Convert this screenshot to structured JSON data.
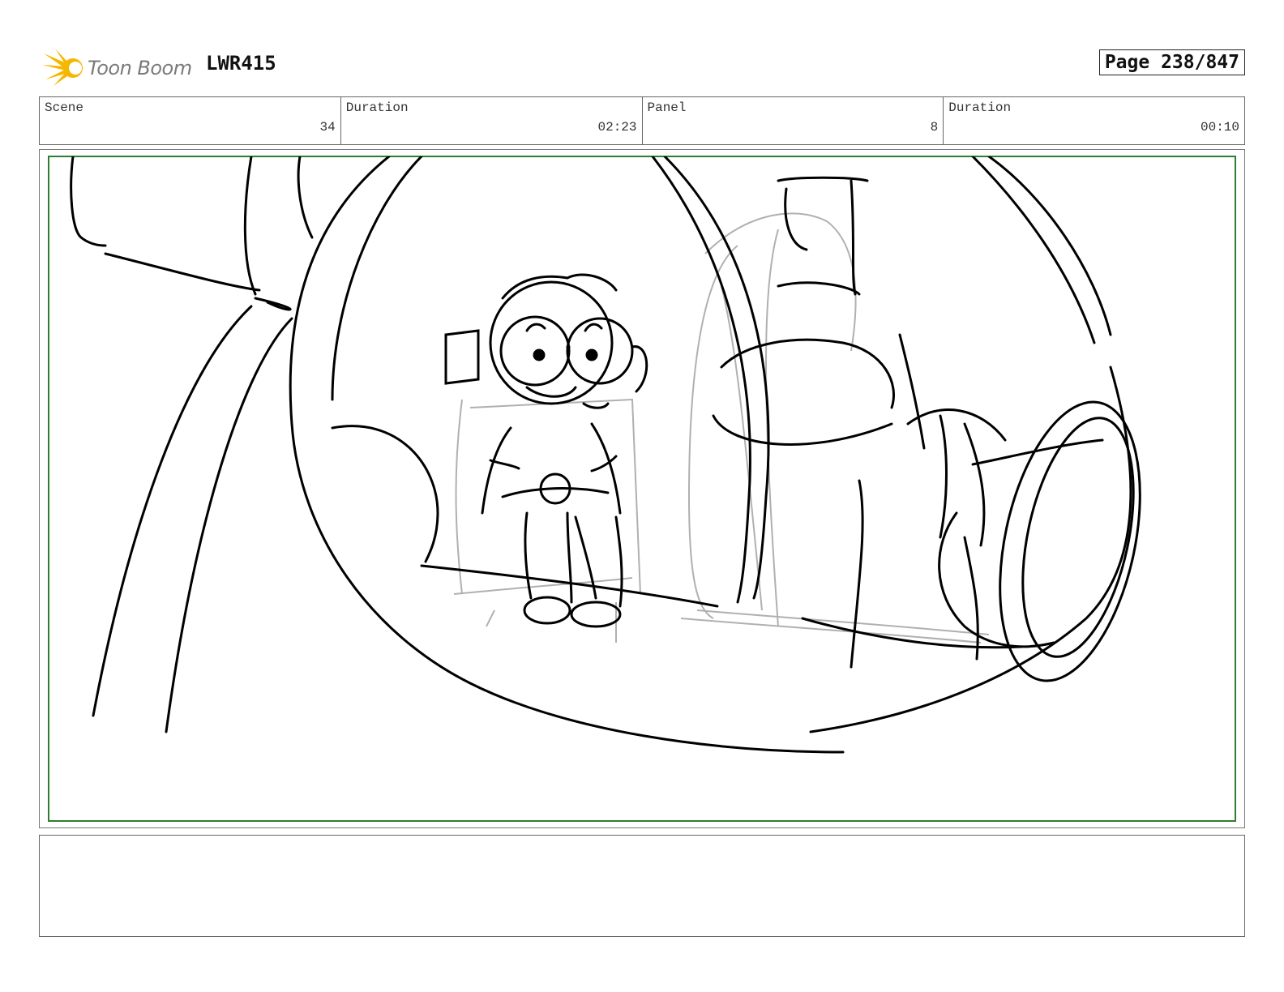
{
  "header": {
    "logo_text": "Toon Boom",
    "project_code": "LWR415",
    "page_label": "Page 238/847"
  },
  "info_bar": {
    "cells": [
      {
        "label": "Scene",
        "value": "34"
      },
      {
        "label": "Duration",
        "value": "02:23"
      },
      {
        "label": "Panel",
        "value": "8"
      },
      {
        "label": "Duration",
        "value": "00:10"
      }
    ]
  },
  "panel": {
    "safe_area_color": "#2e7d32",
    "sketch_line_color": "#000000",
    "sketch_construction_color": "#b0b0b0"
  },
  "notes": {
    "text": ""
  },
  "icons": {
    "logo": "toon-boom-sunburst-icon"
  },
  "colors": {
    "logo_burst": "#f5b800",
    "logo_text": "#7a7a7a"
  }
}
